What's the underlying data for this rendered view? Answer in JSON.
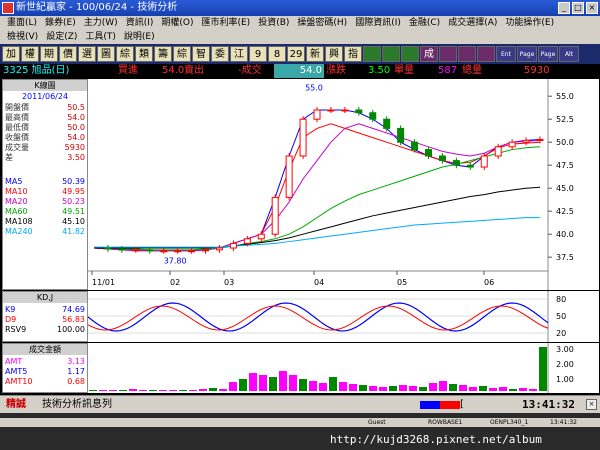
{
  "window": {
    "title": "新世紀贏家 - 100/06/24 - 技術分析"
  },
  "menu": {
    "row1": [
      "畫面(L)",
      "錄券(E)",
      "主力(W)",
      "資訊(I)",
      "期權(O)",
      "匯市利率(E)",
      "投資(B)",
      "操盤密碼(H)",
      "國際資訊(I)",
      "金融(C)",
      "成交選擇(A)",
      "功能操作(E)"
    ],
    "row2": [
      "檢視(V)",
      "設定(Z)",
      "工具(T)",
      "說明(E)"
    ]
  },
  "toolbar": {
    "buttons": [
      "加",
      "權",
      "期",
      "價",
      "選",
      "圖",
      "綜",
      "類",
      "籌",
      "綜",
      "智",
      "委",
      "江",
      "9",
      "8",
      "29",
      "新",
      "興",
      "指",
      "",
      "",
      "",
      "成",
      "",
      "",
      ""
    ],
    "small": [
      "Ent",
      "Page",
      "Page",
      "Alt"
    ]
  },
  "quote": {
    "code_name": "3325 旭品(日)",
    "buy_label": "買進",
    "buy": "54.0",
    "sell_label": "賣出",
    "change": "-成交",
    "last": "54.0",
    "pct_label": "漲跌",
    "diff": "3.50",
    "vol_label": "單量",
    "lot": "587",
    "total_label": "總量",
    "total": "5930"
  },
  "info": {
    "title": "K線圖",
    "date": "2011/06/24",
    "rows": [
      {
        "k": "開盤價",
        "v": "50.5"
      },
      {
        "k": "最高價",
        "v": "54.0"
      },
      {
        "k": "最低價",
        "v": "50.0"
      },
      {
        "k": "收盤價",
        "v": "54.0"
      },
      {
        "k": "成交量",
        "v": "5930"
      },
      {
        "k": "差",
        "v": "3.50"
      }
    ],
    "ma": [
      {
        "k": "MA5",
        "v": "50.39",
        "c": "#0000ff"
      },
      {
        "k": "MA10",
        "v": "49.95",
        "c": "#ff0000"
      },
      {
        "k": "MA20",
        "v": "50.23",
        "c": "#cc00cc"
      },
      {
        "k": "MA60",
        "v": "49.51",
        "c": "#00aa00"
      },
      {
        "k": "MA108",
        "v": "45.10",
        "c": "#000000"
      },
      {
        "k": "MA240",
        "v": "41.82",
        "c": "#00aaff"
      }
    ]
  },
  "kd": {
    "title": "KD,J",
    "rows": [
      {
        "k": "K9",
        "v": "74.69",
        "c": "#0000ff"
      },
      {
        "k": "D9",
        "v": "56.83",
        "c": "#ff0000"
      },
      {
        "k": "RSV9",
        "v": "100.00",
        "c": "#000000"
      }
    ],
    "ticks": [
      "80",
      "50",
      "20"
    ]
  },
  "amt": {
    "title": "成交金額",
    "rows": [
      {
        "k": "AMT",
        "v": "3.13",
        "c": "#ff00ff"
      },
      {
        "k": "AMT5",
        "v": "1.17",
        "c": "#0000ff"
      },
      {
        "k": "AMT10",
        "v": "0.68",
        "c": "#ff0000"
      }
    ],
    "ticks": [
      "3.00",
      "2.00",
      "1.00"
    ]
  },
  "chart_data": {
    "type": "line",
    "ylim": [
      36,
      56
    ],
    "yticks": [
      "55.0",
      "52.5",
      "50.0",
      "47.5",
      "45.0",
      "42.5",
      "40.0",
      "37.5"
    ],
    "xticks": [
      "11/01",
      "02",
      "03",
      "04",
      "05",
      "06"
    ],
    "annotations": [
      "55.0",
      "37.80"
    ],
    "series": [
      {
        "values": [
          38.5,
          38.4,
          38.3,
          38.3,
          38.2,
          38.2,
          38.2,
          38.2,
          38.3,
          38.5,
          39.0,
          39.5,
          40.0,
          44,
          48.5,
          52.5,
          53.5,
          53.5,
          53.5,
          53.2,
          52.5,
          51.5,
          50,
          49.2,
          48.5,
          48,
          47.5,
          47.3,
          48.5,
          49.5,
          50,
          50.2,
          50.3
        ]
      },
      {
        "values": [
          38.5,
          38.4,
          38.3,
          38.2,
          38.2,
          38.2,
          38.2,
          38.2,
          38.3,
          38.5,
          39.0,
          39.5,
          40.0,
          43,
          47,
          50.5,
          51.5,
          52,
          51.5,
          51,
          50.5,
          50,
          49.5,
          49,
          48.5,
          48,
          47.7,
          47.8,
          48.5,
          49.4,
          49.8,
          49.9,
          50
        ]
      },
      {
        "values": [
          38.5,
          38.4,
          38.3,
          38.2,
          38.2,
          38.2,
          38.2,
          38.2,
          38.3,
          38.5,
          39.0,
          39.5,
          40.0,
          41.5,
          43.5,
          46,
          48,
          50,
          51.5,
          52,
          51.5,
          51,
          50.5,
          50,
          49.5,
          49,
          48.7,
          48.5,
          48.8,
          49.5,
          50,
          50.1,
          50.2
        ]
      },
      {
        "values": [
          38.5,
          38.5,
          38.4,
          38.4,
          38.3,
          38.3,
          38.3,
          38.3,
          38.4,
          38.5,
          38.7,
          39.0,
          39.2,
          39.5,
          40.0,
          40.8,
          41.8,
          42.8,
          43.6,
          44.3,
          44.8,
          45.3,
          45.8,
          46.3,
          46.8,
          47.3,
          47.6,
          48,
          48.4,
          48.8,
          49.2,
          49.4,
          49.5
        ]
      },
      {
        "values": [
          38.5,
          38.5,
          38.5,
          38.5,
          38.5,
          38.5,
          38.5,
          38.5,
          38.5,
          38.6,
          38.7,
          38.9,
          39.1,
          39.3,
          39.6,
          40,
          40.4,
          40.8,
          41.2,
          41.6,
          42,
          42.3,
          42.6,
          42.9,
          43.2,
          43.5,
          43.8,
          44.1,
          44.3,
          44.6,
          44.8,
          45,
          45.1
        ]
      },
      {
        "values": [
          38.6,
          38.6,
          38.6,
          38.6,
          38.6,
          38.6,
          38.6,
          38.6,
          38.6,
          38.6,
          38.7,
          38.8,
          38.9,
          39.0,
          39.2,
          39.4,
          39.6,
          39.8,
          40,
          40.2,
          40.4,
          40.6,
          40.8,
          41,
          41.1,
          41.2,
          41.3,
          41.4,
          41.5,
          41.6,
          41.7,
          41.8,
          41.8
        ]
      }
    ]
  },
  "status": {
    "tag": "精誠",
    "message": "技術分析訊息列",
    "bracket": "[",
    "time": "13:41:32",
    "extra": [
      "Guest",
      "ROWBASE1",
      "OENPL340_1",
      "13:41:32"
    ]
  },
  "url": "http://kujd3268.pixnet.net/album"
}
